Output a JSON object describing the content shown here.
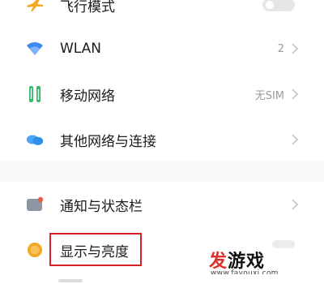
{
  "settings": {
    "airplane": {
      "label": "飞行模式",
      "enabled": false
    },
    "wlan": {
      "label": "WLAN",
      "value": "2"
    },
    "mobile": {
      "label": "移动网络",
      "value": "无SIM"
    },
    "other": {
      "label": "其他网络与连接"
    },
    "notify": {
      "label": "通知与状态栏"
    },
    "display": {
      "label": "显示与亮度"
    }
  },
  "watermark": {
    "text_red": "发",
    "text_black": "游戏",
    "url": "www.fayouxi.com"
  },
  "colors": {
    "highlight": "#d6202a",
    "wifi": "#3d8bf0",
    "mobile": "#38b86a",
    "cloud": "#49a7f5",
    "sun": "#f5a623"
  }
}
